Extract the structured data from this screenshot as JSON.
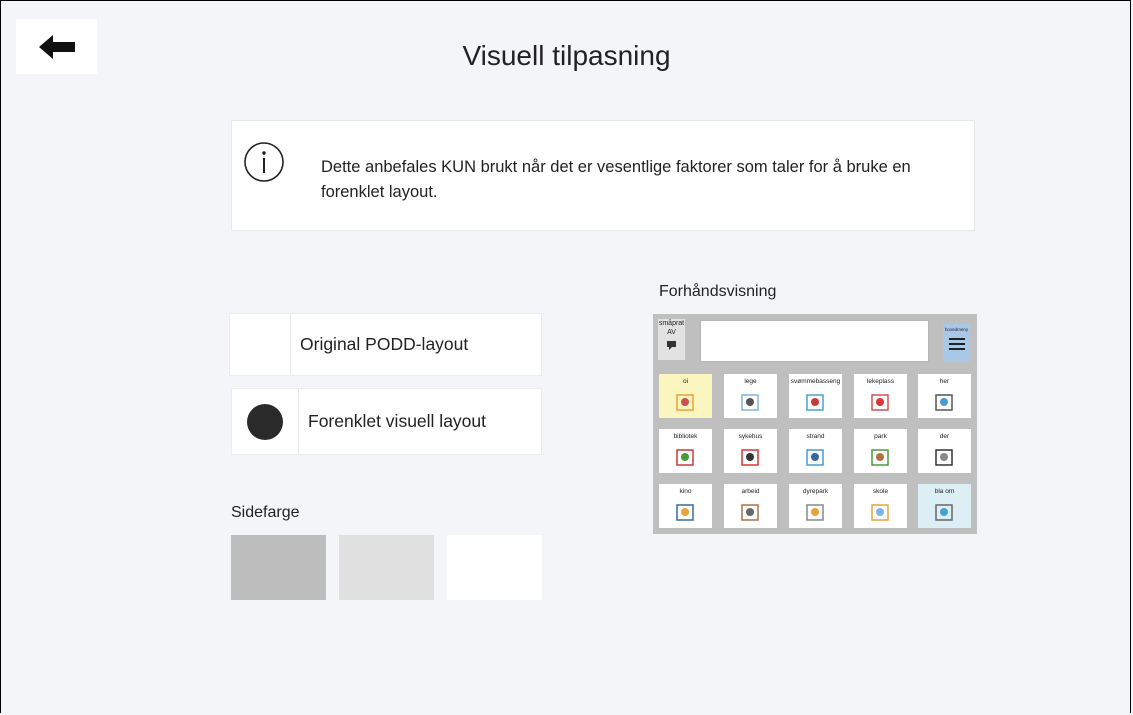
{
  "header": {
    "title": "Visuell tilpasning"
  },
  "info": {
    "text": "Dette anbefales KUN brukt når det er vesentlige faktorer som taler for å bruke en forenklet layout."
  },
  "layout_options": [
    {
      "label": "Original PODD-layout",
      "selected": false
    },
    {
      "label": "Forenklet visuell layout",
      "selected": true
    }
  ],
  "page_color": {
    "label": "Sidefarge",
    "swatches": [
      "#bdbdbd",
      "#e0e0e0",
      "#ffffff"
    ]
  },
  "preview": {
    "label": "Forhåndsvisning",
    "smaprat_line1": "småprat",
    "smaprat_line2": "AV",
    "hovedmeny": "hovedmeny",
    "cells": [
      {
        "label": "oi",
        "bg": "#fbf5c0"
      },
      {
        "label": "lege",
        "bg": "#ffffff"
      },
      {
        "label": "svømmebasseng",
        "bg": "#ffffff"
      },
      {
        "label": "lekeplass",
        "bg": "#ffffff"
      },
      {
        "label": "her",
        "bg": "#ffffff"
      },
      {
        "label": "bibliotek",
        "bg": "#ffffff"
      },
      {
        "label": "sykehus",
        "bg": "#ffffff"
      },
      {
        "label": "strand",
        "bg": "#ffffff"
      },
      {
        "label": "park",
        "bg": "#ffffff"
      },
      {
        "label": "der",
        "bg": "#ffffff"
      },
      {
        "label": "kino",
        "bg": "#ffffff"
      },
      {
        "label": "arbeid",
        "bg": "#ffffff"
      },
      {
        "label": "dyrepark",
        "bg": "#ffffff"
      },
      {
        "label": "skole",
        "bg": "#ffffff"
      },
      {
        "label": "bla om",
        "bg": "#dceff5"
      }
    ]
  }
}
